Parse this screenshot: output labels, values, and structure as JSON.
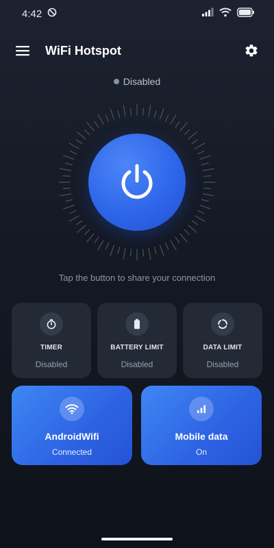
{
  "status_bar": {
    "time": "4:42"
  },
  "app_bar": {
    "title": "WiFi Hotspot"
  },
  "hotspot": {
    "status": "Disabled",
    "hint": "Tap the button to share your connection"
  },
  "stats": [
    {
      "title": "TIMER",
      "value": "Disabled",
      "icon": "timer-icon"
    },
    {
      "title": "BATTERY LIMIT",
      "value": "Disabled",
      "icon": "battery-icon"
    },
    {
      "title": "DATA LIMIT",
      "value": "Disabled",
      "icon": "data-limit-icon"
    }
  ],
  "connections": [
    {
      "title": "AndroidWifi",
      "status": "Connected",
      "icon": "wifi-icon"
    },
    {
      "title": "Mobile data",
      "status": "On",
      "icon": "signal-bars-icon"
    }
  ],
  "colors": {
    "accent": "#2e66ea",
    "card": "#232a36",
    "background": "#141923"
  }
}
